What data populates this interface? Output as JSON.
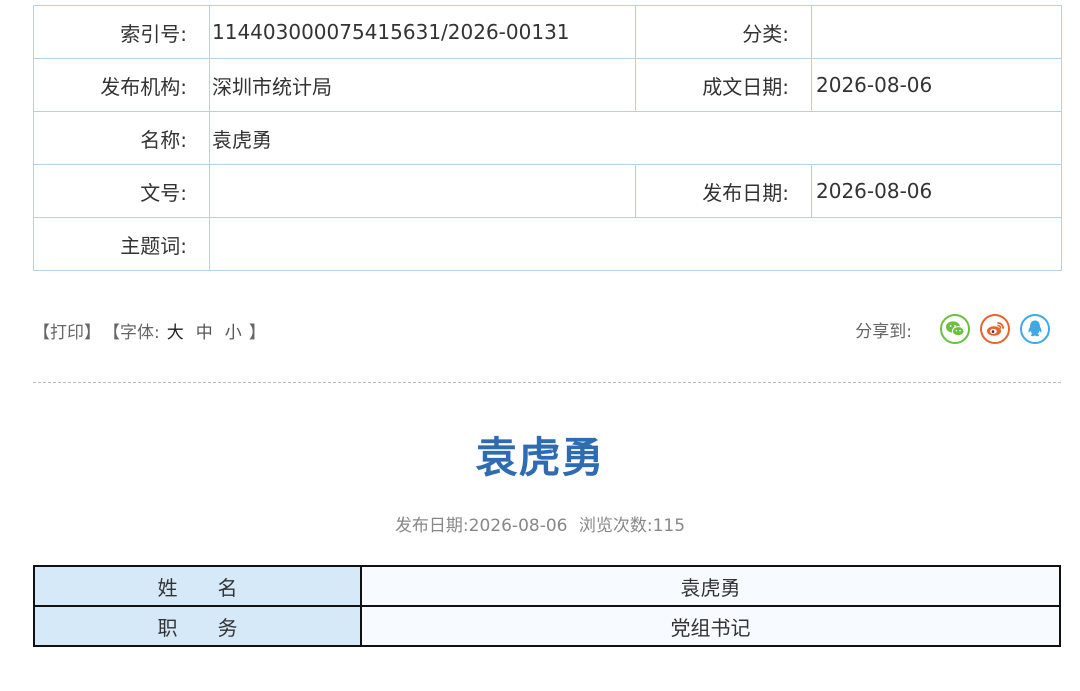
{
  "meta": {
    "index_label": "索引号:",
    "index_value": "11440300007541563​1/2026-00131",
    "category_label": "分类:",
    "category_value": "",
    "publisher_label": "发布机构:",
    "publisher_value": "深圳市统计局",
    "written_date_label": "成文日期:",
    "written_date_value": "2026-08-06",
    "name_label": "名称:",
    "name_value": "袁虎勇",
    "doc_no_label": "文号:",
    "doc_no_value": "",
    "publish_date_label": "发布日期:",
    "publish_date_value": "2026-08-06",
    "subject_label": "主题词:",
    "subject_value": ""
  },
  "tools": {
    "print": "【打印】",
    "font_prefix": "【字体:",
    "size_large": "大",
    "size_medium": "中",
    "size_small": "小",
    "font_suffix": "】"
  },
  "share": {
    "label": "分享到:",
    "icons": [
      "wechat-icon",
      "weibo-icon",
      "qq-icon"
    ],
    "colors": {
      "wechat": "#6cbf3f",
      "weibo": "#e8642c",
      "qq": "#3fa9e8"
    }
  },
  "article": {
    "title": "袁虎勇",
    "publish_date_text": "发布日期:2026-08-06",
    "views_text": "浏览次数:115"
  },
  "profile": {
    "rows": [
      {
        "key": "姓　　名",
        "value": "袁虎勇"
      },
      {
        "key": "职　　务",
        "value": "党组书记"
      }
    ]
  },
  "colors": {
    "title": "#2e6bb0",
    "border": "#b7d0e4",
    "key_cell_bg": "#d6e9f8"
  }
}
